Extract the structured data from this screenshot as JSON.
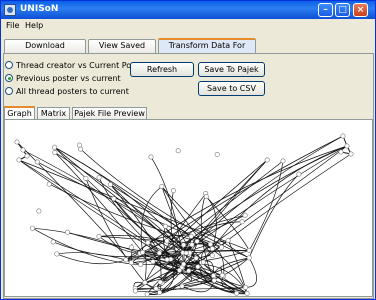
{
  "window": {
    "title": "UNISoN"
  },
  "menu": {
    "file": "File",
    "help": "Help"
  },
  "tabs": [
    {
      "label": "Download Messages"
    },
    {
      "label": "View Saved Data"
    },
    {
      "label": "Transform Data For Pajek"
    }
  ],
  "options": [
    {
      "label": "Thread creator vs Current Poster",
      "selected": false
    },
    {
      "label": "Previous poster vs current",
      "selected": true
    },
    {
      "label": "All thread posters to current",
      "selected": false
    }
  ],
  "buttons": {
    "refresh": "Refresh",
    "save_pajek": "Save To Pajek",
    "save_csv": "Save to CSV"
  },
  "subtabs": [
    {
      "label": "Graph"
    },
    {
      "label": "Matrix"
    },
    {
      "label": "Pajek File Preview"
    }
  ],
  "colors": {
    "titlebar": "#0a5fe8",
    "active_tab_accent": "#e68b2c"
  }
}
